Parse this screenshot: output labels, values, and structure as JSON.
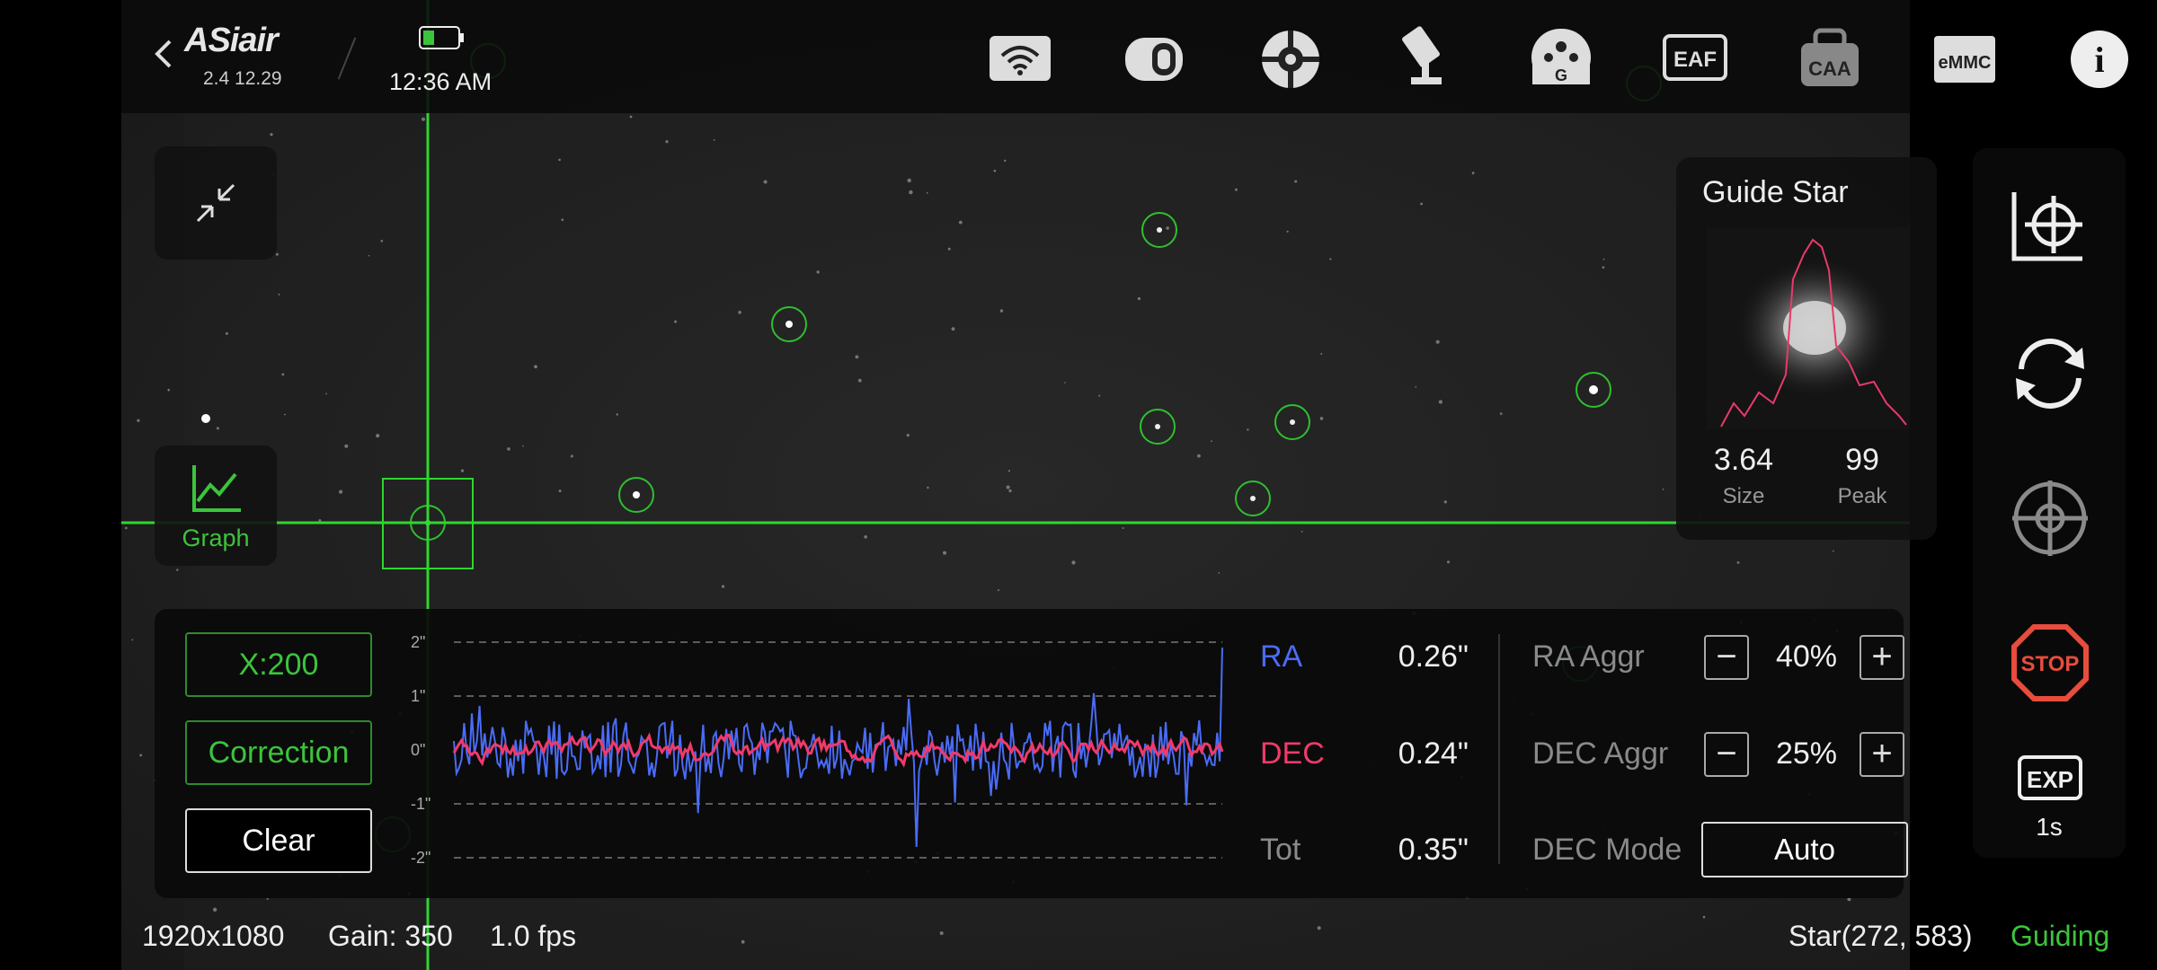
{
  "header": {
    "app_name": "ASiair",
    "version": "2.4 12.29",
    "time": "12:36 AM",
    "icons": [
      {
        "name": "wifi-icon"
      },
      {
        "name": "camera-icon"
      },
      {
        "name": "guide-camera-icon"
      },
      {
        "name": "mount-icon"
      },
      {
        "name": "guide-icon",
        "text": "G"
      },
      {
        "name": "eaf-icon",
        "text": "EAF"
      },
      {
        "name": "caa-icon",
        "text": "CAA"
      },
      {
        "name": "emmc-icon",
        "text": "eMMC"
      },
      {
        "name": "info-icon",
        "text": "i"
      }
    ]
  },
  "left": {
    "graph_label": "Graph"
  },
  "guide_star": {
    "title": "Guide Star",
    "size_value": "3.64",
    "size_label": "Size",
    "peak_value": "99",
    "peak_label": "Peak"
  },
  "graph_panel": {
    "x_scale": "X:200",
    "correction_label": "Correction",
    "clear_label": "Clear",
    "y_ticks": [
      "2\"",
      "1\"",
      "0\"",
      "-1\"",
      "-2\""
    ],
    "ra_label": "RA",
    "ra_value": "0.26\"",
    "dec_label": "DEC",
    "dec_value": "0.24\"",
    "tot_label": "Tot",
    "tot_value": "0.35\"",
    "ra_aggr_label": "RA Aggr",
    "ra_aggr_value": "40%",
    "dec_aggr_label": "DEC Aggr",
    "dec_aggr_value": "25%",
    "dec_mode_label": "DEC Mode",
    "dec_mode_value": "Auto",
    "ra_color": "#4a6cf7",
    "dec_color": "#f03a6b"
  },
  "right_toolbar": {
    "exp_label": "EXP",
    "exp_value": "1s"
  },
  "status_bar": {
    "resolution": "1920x1080",
    "gain": "Gain: 350",
    "fps": "1.0 fps",
    "star": "Star(272, 583)",
    "state": "Guiding"
  },
  "colors": {
    "accent": "#3cc43c",
    "stop": "#e84c3c"
  }
}
